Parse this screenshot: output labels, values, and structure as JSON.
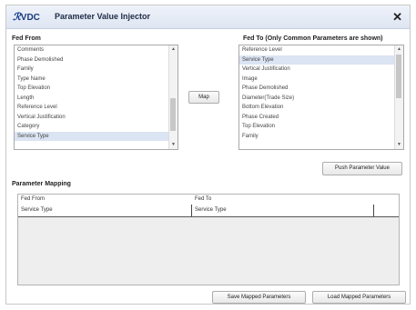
{
  "window": {
    "logo_text": "VDC",
    "title": "Parameter Value Injector",
    "close_glyph": "✕"
  },
  "fed_from": {
    "label": "Fed From",
    "items": [
      "Comments",
      "Phase Demolished",
      "Family",
      "Type Name",
      "Top Elevation",
      "Length",
      "Reference Level",
      "Vertical Justification",
      "Category",
      "Service Type"
    ],
    "selected": "Service Type"
  },
  "fed_to": {
    "label": "Fed To (Only Common Parameters are shown)",
    "items": [
      "Reference Level",
      "Service Type",
      "Vertical Justification",
      "Image",
      "Phase Demolished",
      "Diameter(Trade Size)",
      "Bottom Elevation",
      "Phase Created",
      "Top Elevation",
      "Family"
    ],
    "selected": "Service Type"
  },
  "buttons": {
    "map": "Map",
    "push": "Push Parameter Value",
    "save": "Save Mapped Parameters",
    "load": "Load Mapped Parameters"
  },
  "mapping": {
    "label": "Parameter Mapping",
    "columns": [
      "Fed From",
      "Fed To"
    ],
    "rows": [
      [
        "Service Type",
        "Service Type"
      ]
    ]
  },
  "icons": {
    "scroll_up": "up-arrow-icon",
    "scroll_down": "down-arrow-icon",
    "close": "close-icon"
  }
}
